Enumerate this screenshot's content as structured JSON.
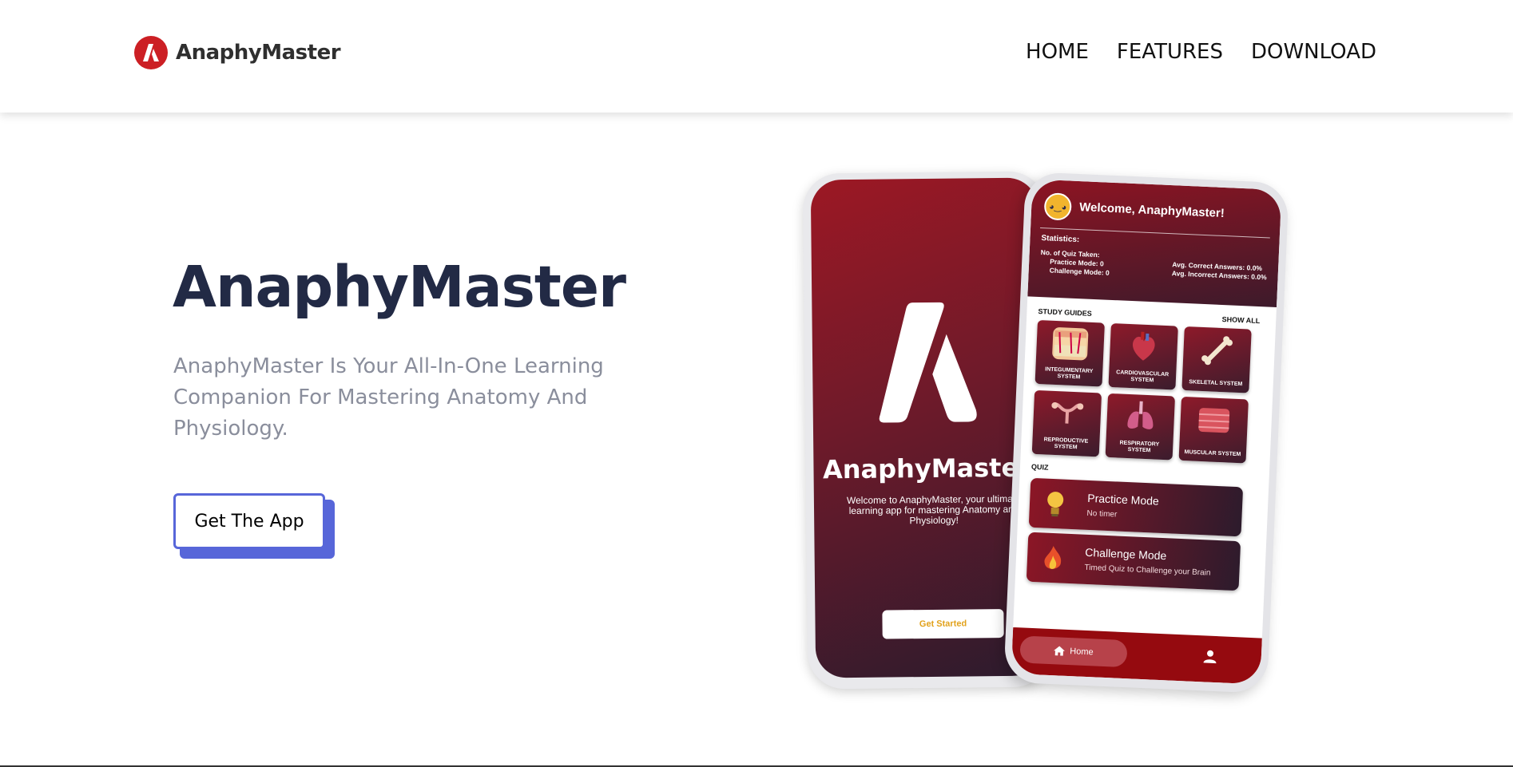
{
  "navbar": {
    "brand": "AnaphyMaster",
    "links": [
      {
        "label": "HOME"
      },
      {
        "label": "FEATURES"
      },
      {
        "label": "DOWNLOAD"
      }
    ]
  },
  "hero": {
    "title": "AnaphyMaster",
    "description": "AnaphyMaster Is Your All-In-One Learning Companion For Mastering Anatomy And Physiology.",
    "cta_label": "Get The App",
    "accent_color": "#5766d9"
  },
  "phone_splash": {
    "title": "AnaphyMaster",
    "text": "Welcome to AnaphyMaster, your ultimate learning app for mastering Anatomy and Physiology!",
    "button_label": "Get Started"
  },
  "phone_app": {
    "welcome": "Welcome, AnaphyMaster!",
    "stats_title": "Statistics:",
    "quiz_taken_label": "No. of Quiz Taken:",
    "practice_mode_stat": "Practice Mode: 0",
    "challenge_mode_stat": "Challenge Mode: 0",
    "avg_correct": "Avg. Correct Answers: 0.0%",
    "avg_incorrect": "Avg. Incorrect Answers: 0.0%",
    "study_guides_label": "STUDY GUIDES",
    "show_all_label": "SHOW ALL",
    "guides": [
      {
        "label": "INTEGUMENTARY SYSTEM",
        "icon": "skin-icon"
      },
      {
        "label": "CARDIOVASCULAR SYSTEM",
        "icon": "heart-icon"
      },
      {
        "label": "SKELETAL SYSTEM",
        "icon": "bone-icon"
      },
      {
        "label": "REPRODUCTIVE SYSTEM",
        "icon": "reproductive-icon"
      },
      {
        "label": "RESPIRATORY SYSTEM",
        "icon": "lungs-icon"
      },
      {
        "label": "MUSCULAR SYSTEM",
        "icon": "muscle-icon"
      }
    ],
    "quiz_label": "QUIZ",
    "practice": {
      "title": "Practice Mode",
      "subtitle": "No timer",
      "icon": "lightbulb-icon"
    },
    "challenge": {
      "title": "Challenge Mode",
      "subtitle": "Timed Quiz to Challenge your Brain",
      "icon": "fire-icon"
    },
    "nav_home_label": "Home"
  },
  "colors": {
    "brand_red": "#cc1f24",
    "title_navy": "#222a45",
    "app_red": "#950a0f"
  }
}
